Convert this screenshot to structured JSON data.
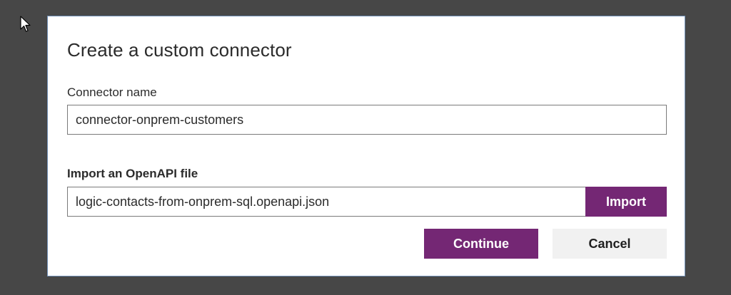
{
  "dialog": {
    "title": "Create a custom connector",
    "connector_name": {
      "label": "Connector name",
      "value": "connector-onprem-customers"
    },
    "openapi_import": {
      "label": "Import an OpenAPI file",
      "value": "logic-contacts-from-onprem-sql.openapi.json",
      "button_label": "Import"
    },
    "actions": {
      "continue_label": "Continue",
      "cancel_label": "Cancel"
    }
  },
  "colors": {
    "backdrop": "#474747",
    "accent": "#742774",
    "secondary_button": "#f1f1f1",
    "dialog_border": "#6f8db3"
  },
  "icons": {
    "pointer": "mouse-pointer-icon"
  }
}
